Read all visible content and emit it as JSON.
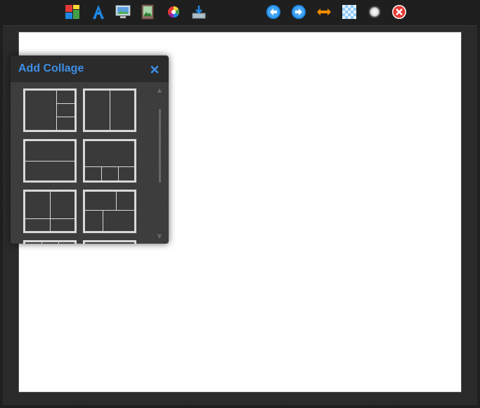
{
  "toolbar": {
    "tools": [
      {
        "icon": "collage-icon"
      },
      {
        "icon": "text-icon"
      },
      {
        "icon": "background-icon"
      },
      {
        "icon": "image-icon"
      },
      {
        "icon": "color-wheel-icon"
      },
      {
        "icon": "save-icon"
      },
      {
        "icon": "undo-icon"
      },
      {
        "icon": "redo-icon"
      },
      {
        "icon": "flip-icon"
      },
      {
        "icon": "transparency-icon"
      },
      {
        "icon": "shadow-icon"
      },
      {
        "icon": "close-icon"
      }
    ]
  },
  "panel": {
    "title": "Add Collage",
    "close_symbol": "×"
  },
  "colors": {
    "accent": "#3d8ee6",
    "tile_border": "#d8d8d8",
    "panel_bg": "#3b3b3b",
    "canvas": "#ffffff"
  }
}
